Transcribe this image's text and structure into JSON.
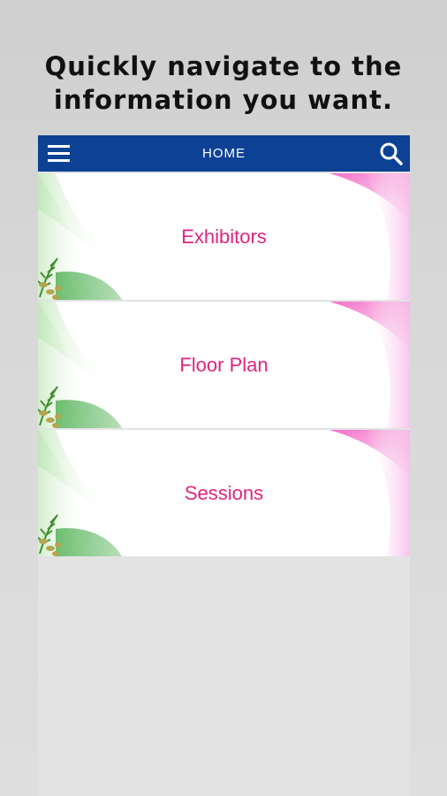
{
  "promo": {
    "line1": "Quickly navigate to the",
    "line2": "information you want."
  },
  "app_bar": {
    "title": "HOME",
    "menu_icon": "hamburger-menu-icon",
    "search_icon": "search-icon",
    "background_color": "#0d4194"
  },
  "menu": {
    "items": [
      {
        "label": "Exhibitors"
      },
      {
        "label": "Floor Plan"
      },
      {
        "label": "Sessions"
      }
    ],
    "label_color": "#e0237f"
  }
}
